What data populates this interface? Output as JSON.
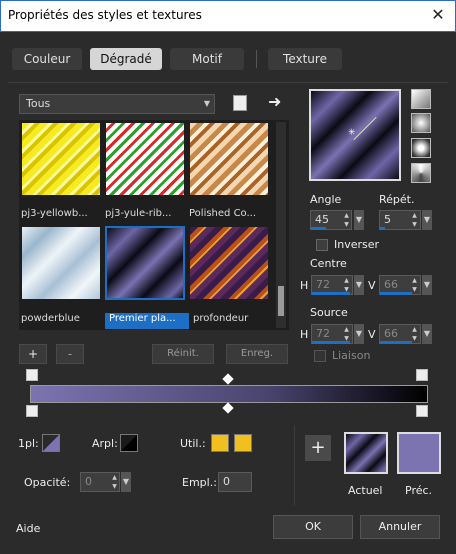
{
  "window": {
    "title": "Propriétés des styles et textures"
  },
  "tabs": [
    {
      "label": "Couleur",
      "active": false
    },
    {
      "label": "Dégradé",
      "active": true
    },
    {
      "label": "Motif",
      "active": false
    },
    {
      "label": "Texture",
      "active": false
    }
  ],
  "gallery": {
    "category": "Tous",
    "items": [
      {
        "label": "pj3-yellowb..."
      },
      {
        "label": "pj3-yule-rib..."
      },
      {
        "label": "Polished Co..."
      },
      {
        "label": "powderblue"
      },
      {
        "label": "Premier pla...",
        "selected": true
      },
      {
        "label": "profondeur"
      }
    ],
    "add_label": "+",
    "remove_label": "-",
    "reset_label": "Réinit.",
    "save_label": "Enreg."
  },
  "controls": {
    "angle_label": "Angle",
    "angle_value": "45",
    "repeat_label": "Répét.",
    "repeat_value": "5",
    "invert_label": "Inverser",
    "centre_label": "Centre",
    "centre_h_label": "H",
    "centre_h_value": "72",
    "centre_v_label": "V",
    "centre_v_value": "66",
    "source_label": "Source",
    "source_h_label": "H",
    "source_h_value": "72",
    "source_v_label": "V",
    "source_v_value": "66",
    "link_label": "Liaison"
  },
  "editor": {
    "fg_label": "1pl:",
    "bg_label": "Arpl:",
    "user_label": "Util.:",
    "opacity_label": "Opacité:",
    "opacity_value": "0",
    "location_label": "Empl.:",
    "location_value": "0"
  },
  "preview": {
    "current_label": "Actuel",
    "previous_label": "Préc.",
    "add_label": "+"
  },
  "footer": {
    "help_label": "Aide",
    "ok_label": "OK",
    "cancel_label": "Annuler"
  },
  "colors": {
    "gradient_start": "#7c74b0",
    "gradient_end": "#000000",
    "user_color": "#f0c020",
    "accent": "#1c6fc4"
  }
}
